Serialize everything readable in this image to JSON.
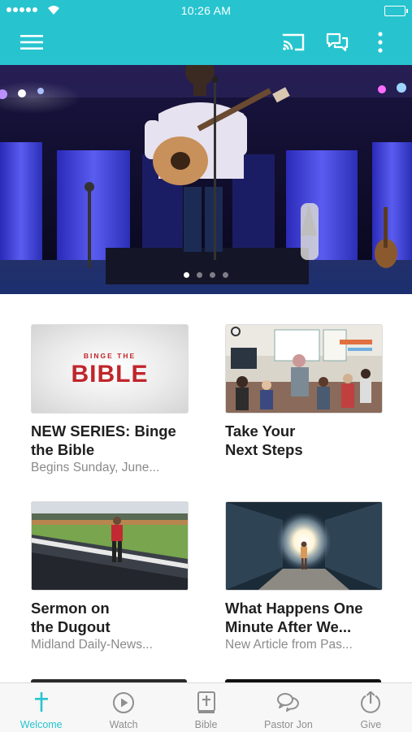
{
  "status_bar": {
    "time": "10:26 AM"
  },
  "app_bar": {
    "icons": [
      "menu-icon",
      "cast-icon",
      "chat-icon",
      "more-vertical-icon"
    ]
  },
  "hero": {
    "slide_count": 4,
    "active_slide": 1
  },
  "cards": [
    {
      "thumb_text_small": "BINGE THE",
      "thumb_text_big": "BIBLE",
      "title": "NEW SERIES: Binge\nthe Bible",
      "subtitle": "Begins Sunday, June..."
    },
    {
      "title": "Take Your\nNext Steps",
      "subtitle": ""
    },
    {
      "title": "Sermon on\nthe Dugout",
      "subtitle": "Midland Daily-News..."
    },
    {
      "title": "What Happens One\nMinute After We...",
      "subtitle": "New Article from Pas..."
    }
  ],
  "tabs": [
    {
      "label": "Welcome",
      "icon": "cross-icon",
      "active": true
    },
    {
      "label": "Watch",
      "icon": "play-circle-icon",
      "active": false
    },
    {
      "label": "Bible",
      "icon": "bible-icon",
      "active": false
    },
    {
      "label": "Pastor Jon",
      "icon": "chat-bubbles-icon",
      "active": false
    },
    {
      "label": "Give",
      "icon": "give-icon",
      "active": false
    }
  ],
  "colors": {
    "accent": "#27c4cf",
    "tab_inactive": "#8f8f8f",
    "subtitle": "#8a8a8a"
  }
}
